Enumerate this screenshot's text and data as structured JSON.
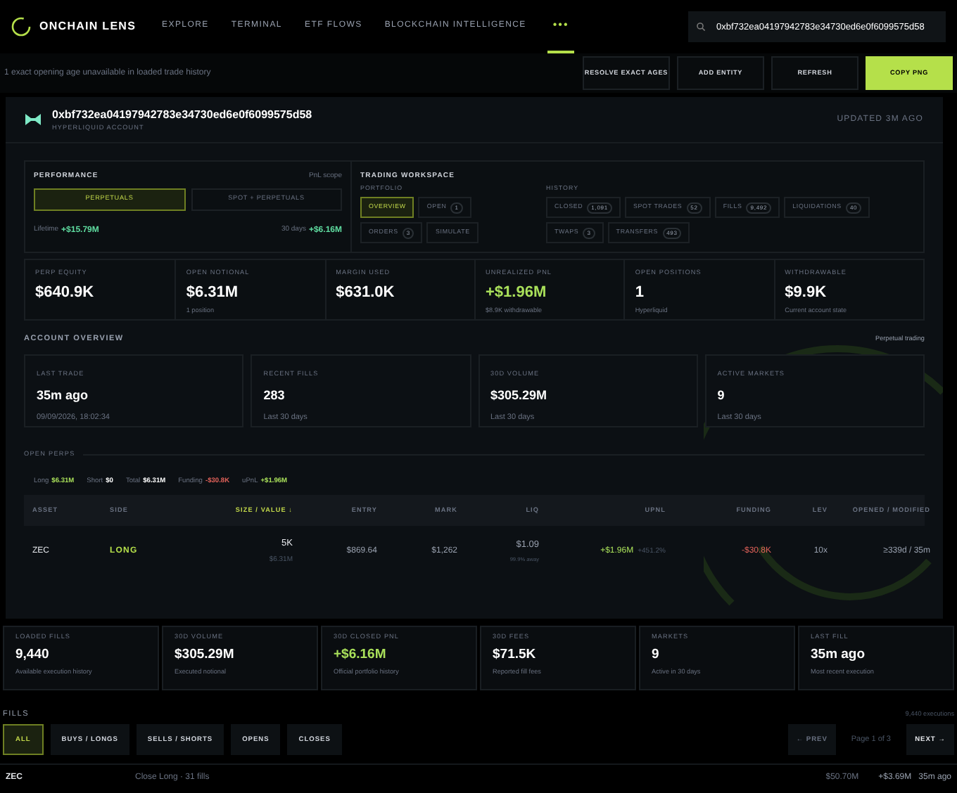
{
  "brand": "ONCHAIN LENS",
  "nav": [
    {
      "label": "EXPLORE",
      "selected": false
    },
    {
      "label": "TERMINAL",
      "selected": false
    },
    {
      "label": "ETF FLOWS",
      "selected": false
    },
    {
      "label": "BLOCKCHAIN INTELLIGENCE",
      "selected": false
    },
    {
      "label": "•••",
      "selected": true
    }
  ],
  "search": {
    "value": "0xbf732ea04197942783e34730ed6e0f6099575d58"
  },
  "notice": "1 exact opening age unavailable in loaded trade history",
  "actions": [
    {
      "label": "RESOLVE EXACT AGES",
      "kind": "default"
    },
    {
      "label": "ADD ENTITY",
      "kind": "default"
    },
    {
      "label": "REFRESH",
      "kind": "default"
    },
    {
      "label": "COPY PNG",
      "kind": "primary"
    }
  ],
  "account": {
    "address": "0xbf732ea04197942783e34730ed6e0f6099575d58",
    "subtitle": "HYPERLIQUID ACCOUNT",
    "updated": "UPDATED 3M AGO"
  },
  "performance": {
    "title": "PERFORMANCE",
    "scope_label": "PnL scope",
    "tabs": [
      {
        "label": "PERPETUALS",
        "selected": true
      },
      {
        "label": "SPOT + PERPETUALS",
        "selected": false
      }
    ],
    "lifetime_label": "Lifetime",
    "lifetime_value": "+$15.79M",
    "period_label": "30 days",
    "period_value": "+$6.16M"
  },
  "workspace": {
    "title": "TRADING WORKSPACE",
    "portfolio_label": "PORTFOLIO",
    "portfolio": [
      {
        "label": "OVERVIEW",
        "selected": true
      },
      {
        "label": "OPEN",
        "count": "1",
        "selected": false
      },
      {
        "label": "ORDERS",
        "count": "3",
        "selected": false
      },
      {
        "label": "SIMULATE",
        "selected": false
      }
    ],
    "history_label": "HISTORY",
    "history": [
      {
        "label": "CLOSED",
        "count": "1,091",
        "selected": false
      },
      {
        "label": "SPOT TRADES",
        "count": "52",
        "selected": false
      },
      {
        "label": "FILLS",
        "count": "9,492",
        "selected": false
      },
      {
        "label": "LIQUIDATIONS",
        "count": "40",
        "selected": false
      },
      {
        "label": "TWAPS",
        "count": "3",
        "selected": false
      },
      {
        "label": "TRANSFERS",
        "count": "493",
        "selected": false
      }
    ]
  },
  "metrics": [
    {
      "label": "PERP EQUITY",
      "value": "$640.9K",
      "color": "#ffffff"
    },
    {
      "label": "OPEN NOTIONAL",
      "value": "$6.31M",
      "sub": "1 position",
      "color": "#ffffff"
    },
    {
      "label": "MARGIN USED",
      "value": "$631.0K",
      "color": "#ffffff"
    },
    {
      "label": "UNREALIZED PNL",
      "value": "+$1.96M",
      "sub": "$8.9K withdrawable",
      "color": "#a9e05a"
    },
    {
      "label": "OPEN POSITIONS",
      "value": "1",
      "sub": "Hyperliquid",
      "color": "#ffffff"
    },
    {
      "label": "WITHDRAWABLE",
      "value": "$9.9K",
      "sub": "Current account state",
      "color": "#ffffff"
    }
  ],
  "overview": {
    "title": "ACCOUNT OVERVIEW",
    "note": "Perpetual trading",
    "cards": [
      {
        "label": "LAST TRADE",
        "value": "35m ago",
        "sub": "09/09/2026, 18:02:34"
      },
      {
        "label": "RECENT FILLS",
        "value": "283",
        "sub": "Last 30 days"
      },
      {
        "label": "30D VOLUME",
        "value": "$305.29M",
        "sub": "Last 30 days"
      },
      {
        "label": "ACTIVE MARKETS",
        "value": "9",
        "sub": "Last 30 days"
      }
    ]
  },
  "open_perps": {
    "title": "OPEN PERPS",
    "summary": [
      {
        "label": "Long",
        "value": "$6.31M",
        "color": "#a9e05a"
      },
      {
        "label": "Short",
        "value": "$0",
        "color": "#ffffff"
      },
      {
        "label": "Total",
        "value": "$6.31M",
        "color": "#ffffff"
      },
      {
        "label": "Funding",
        "value": "-$30.8K",
        "color": "#e2625a"
      },
      {
        "label": "uPnL",
        "value": "+$1.96M",
        "color": "#a9e05a"
      }
    ],
    "columns": [
      {
        "label": "ASSET",
        "sorted": false
      },
      {
        "label": "SIDE",
        "sorted": false
      },
      {
        "label": "SIZE / VALUE ↓",
        "sorted": true
      },
      {
        "label": "ENTRY",
        "sorted": false
      },
      {
        "label": "MARK",
        "sorted": false
      },
      {
        "label": "LIQ",
        "sorted": false
      },
      {
        "label": "UPNL",
        "sorted": false
      },
      {
        "label": "FUNDING",
        "sorted": false
      },
      {
        "label": "LEV",
        "sorted": false
      },
      {
        "label": "OPENED / MODIFIED",
        "sorted": false
      }
    ],
    "rows": [
      {
        "asset": "ZEC",
        "side": "LONG",
        "size": "5K",
        "value": "$6.31M",
        "entry": "$869.64",
        "mark": "$1,262",
        "liq": "$1.09",
        "liq_note": "99.9% away",
        "upnl": "+$1.96M",
        "upnl_pct": "+451.2%",
        "funding": "-$30.8K",
        "lev": "10x",
        "opened": "≥339d / 35m"
      }
    ]
  },
  "fill_stats": [
    {
      "label": "LOADED FILLS",
      "value": "9,440",
      "sub": "Available execution history",
      "color": "#ffffff"
    },
    {
      "label": "30D VOLUME",
      "value": "$305.29M",
      "sub": "Executed notional",
      "color": "#ffffff"
    },
    {
      "label": "30D CLOSED PNL",
      "value": "+$6.16M",
      "sub": "Official portfolio history",
      "color": "#a9e05a"
    },
    {
      "label": "30D FEES",
      "value": "$71.5K",
      "sub": "Reported fill fees",
      "color": "#ffffff"
    },
    {
      "label": "MARKETS",
      "value": "9",
      "sub": "Active in 30 days",
      "color": "#ffffff"
    },
    {
      "label": "LAST FILL",
      "value": "35m ago",
      "sub": "Most recent execution",
      "color": "#ffffff"
    }
  ],
  "fills": {
    "title": "FILLS",
    "count": "9,440 executions",
    "filters": [
      {
        "label": "ALL",
        "selected": true
      },
      {
        "label": "BUYS / LONGS",
        "selected": false
      },
      {
        "label": "SELLS / SHORTS",
        "selected": false
      },
      {
        "label": "OPENS",
        "selected": false
      },
      {
        "label": "CLOSES",
        "selected": false
      }
    ],
    "prev": {
      "label": "← PREV",
      "disabled": true
    },
    "page": "Page 1 of 3",
    "next": {
      "label": "NEXT →",
      "disabled": false
    },
    "rows": [
      {
        "asset": "ZEC",
        "description": "Close Long · 31 fills",
        "value": "$50.70M",
        "pnl": "+$3.69M",
        "age": "35m ago"
      }
    ]
  }
}
